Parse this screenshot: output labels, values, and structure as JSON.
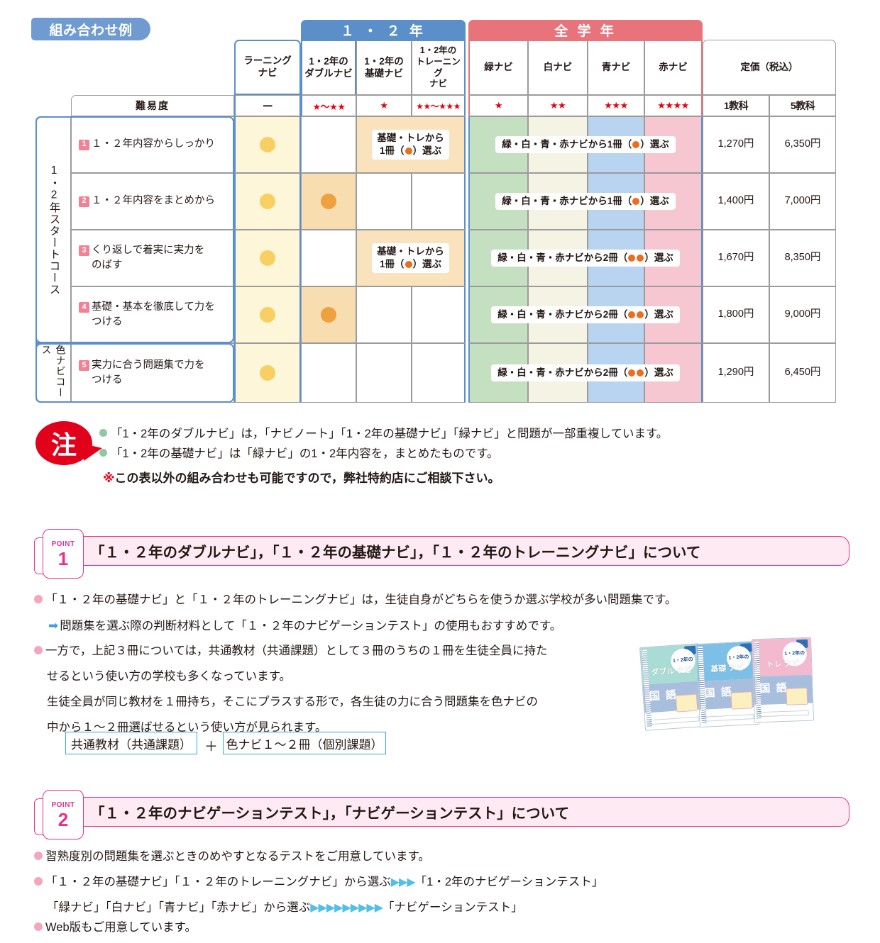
{
  "title_tag": "組み合わせ例",
  "table": {
    "bands": [
      {
        "label": "１ ・ ２ 年",
        "color": "#5b8fc9"
      },
      {
        "label": "全 学 年",
        "color": "#e8737b"
      }
    ],
    "columns": [
      {
        "name": "ラーニング\nナビ",
        "line1": "ラーニング",
        "line2": "ナビ",
        "difficulty": "ー"
      },
      {
        "name": "1・2年の\nダブルナビ",
        "line1": "1・2年の",
        "line2": "ダブルナビ",
        "difficulty": "★〜★★"
      },
      {
        "name": "1・2年の\n基礎ナビ",
        "line1": "1・2年の",
        "line2": "基礎ナビ",
        "difficulty": "★"
      },
      {
        "name": "1・2年の\nトレーニングナビ",
        "line1": "1・2年の",
        "line2": "トレーニング",
        "line3": "ナビ",
        "difficulty": "★★〜★★★"
      },
      {
        "name": "緑ナビ",
        "line1": "緑ナビ",
        "difficulty": "★"
      },
      {
        "name": "白ナビ",
        "line1": "白ナビ",
        "difficulty": "★★"
      },
      {
        "name": "青ナビ",
        "line1": "青ナビ",
        "difficulty": "★★★"
      },
      {
        "name": "赤ナビ",
        "line1": "赤ナビ",
        "difficulty": "★★★★"
      }
    ],
    "difficulty_label": "難易度",
    "price_header": "定価（税込）",
    "price_sub": [
      "1教科",
      "5教科"
    ],
    "course_labels": [
      {
        "text": "1・2年スタートコース",
        "rows": 4
      },
      {
        "text": "色ナビコース",
        "rows": 1
      }
    ],
    "rows": [
      {
        "no": "1",
        "name_l1": "１・２年内容からしっかり",
        "name_l2": "",
        "learning_dot": "light",
        "double_dot": "",
        "kiso_pill_l1": "基礎・トレから",
        "kiso_pill_l2": "1冊（●）選ぶ",
        "color_pill": "緑・白・青・赤ナビから1冊（●）選ぶ",
        "color_pill_dots": 1,
        "price1": "1,270円",
        "price5": "6,350円"
      },
      {
        "no": "2",
        "name_l1": "１・２年内容をまとめから",
        "name_l2": "",
        "learning_dot": "light",
        "double_dot": "dark",
        "kiso_pill_l1": "",
        "kiso_pill_l2": "",
        "color_pill": "緑・白・青・赤ナビから1冊（●）選ぶ",
        "color_pill_dots": 1,
        "price1": "1,400円",
        "price5": "7,000円"
      },
      {
        "no": "3",
        "name_l1": "くり返しで着実に実力を",
        "name_l2": "のばす",
        "learning_dot": "light",
        "double_dot": "",
        "kiso_pill_l1": "基礎・トレから",
        "kiso_pill_l2": "1冊（●）選ぶ",
        "color_pill": "緑・白・青・赤ナビから2冊（●●）選ぶ",
        "color_pill_dots": 2,
        "price1": "1,670円",
        "price5": "8,350円"
      },
      {
        "no": "4",
        "name_l1": "基礎・基本を徹底して力を",
        "name_l2": "つける",
        "learning_dot": "light",
        "double_dot": "dark",
        "kiso_pill_l1": "",
        "kiso_pill_l2": "",
        "color_pill": "緑・白・青・赤ナビから2冊（●●）選ぶ",
        "color_pill_dots": 2,
        "price1": "1,800円",
        "price5": "9,000円"
      },
      {
        "no": "5",
        "name_l1": "実力に合う問題集で力を",
        "name_l2": "つける",
        "learning_dot": "light",
        "double_dot": "",
        "kiso_pill_l1": "",
        "kiso_pill_l2": "",
        "color_pill": "緑・白・青・赤ナビから2冊（●●）選ぶ",
        "color_pill_dots": 2,
        "price1": "1,290円",
        "price5": "6,450円"
      }
    ],
    "cell_colors": {
      "learning": "#fdf6d8",
      "double": "#f8ddb0",
      "training": "#fae2bd",
      "green": "#c5e0c0",
      "white": "#f5f3e4",
      "blue": "#b8d4f0",
      "red": "#f6c7d0"
    }
  },
  "notes": {
    "badge": "注",
    "items": [
      "「1・2年のダブルナビ」は，「ナビノート」「1・2年の基礎ナビ」「緑ナビ」と問題が一部重複しています。",
      "「1・2年の基礎ナビ」は「緑ナビ」の1・2年内容を，まとめたものです。"
    ],
    "footnote_mark": "※",
    "footnote": "この表以外の組み合わせも可能ですので，弊社特約店にご相談下さい。"
  },
  "point1": {
    "word": "POINT",
    "number": "1",
    "title": "「１・２年のダブルナビ」，「１・２年の基礎ナビ」，「１・２年のトレーニングナビ」について",
    "lines": [
      {
        "bullet": "dot",
        "text": "「１・２年の基礎ナビ」と「１・２年のトレーニングナビ」は，生徒自身がどちらを使うか選ぶ学校が多い問題集です。"
      },
      {
        "bullet": "arrow",
        "text": "問題集を選ぶ際の判断材料として「１・２年のナビゲーションテスト」の使用もおすすめです。"
      },
      {
        "bullet": "dot",
        "text": "一方で，上記３冊については，共通教材（共通課題）として３冊のうちの１冊を生徒全員に持た"
      },
      {
        "bullet": "none",
        "text": "せるという使い方の学校も多くなっています。"
      },
      {
        "bullet": "none",
        "text": "生徒全員が同じ教材を１冊持ち，そこにプラスする形で，各生徒の力に合う問題集を色ナビの"
      },
      {
        "bullet": "none",
        "text": "中から１〜２冊選ばせるという使い方が見られます。"
      }
    ],
    "formula": {
      "left": "共通教材（共通課題）",
      "operator": "＋",
      "right": "色ナビ１〜２冊（個別課題）"
    },
    "books": [
      {
        "brand": "ダブル ナビ",
        "grade": "1・2年の",
        "subject": "国 語",
        "top_color": "#a9dcd5"
      },
      {
        "brand": "基礎 ナビ",
        "grade": "1・2年の",
        "subject": "国 語",
        "top_color": "#7cc0e8"
      },
      {
        "brand": "トレ ナビ",
        "grade": "1・2年の",
        "subject": "国 語",
        "top_color": "#f3b9ce"
      }
    ]
  },
  "point2": {
    "word": "POINT",
    "number": "2",
    "title": "「１・２年のナビゲーションテスト」，「ナビゲーションテスト」について",
    "lines": [
      {
        "bullet": "dot",
        "text": "習熟度別の問題集を選ぶときのめやすとなるテストをご用意しています。"
      }
    ],
    "flow1": {
      "left": "「１・２年の基礎ナビ」「１・２年のトレーニングナビ」から選ぶ",
      "arrows": 3,
      "right": "「1・2年のナビゲーションテスト」"
    },
    "flow2": {
      "left": "「緑ナビ」「白ナビ」「青ナビ」「赤ナビ」から選ぶ",
      "arrows": 9,
      "right": "「ナビゲーションテスト」"
    },
    "last_line": "Web版もご用意しています。"
  }
}
